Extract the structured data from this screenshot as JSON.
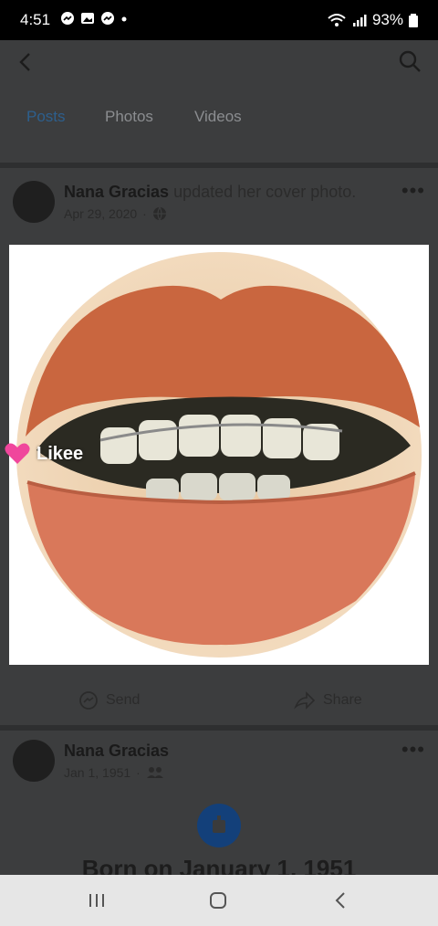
{
  "status_bar": {
    "time": "4:51",
    "battery": "93%"
  },
  "tabs": [
    {
      "label": "Posts"
    },
    {
      "label": "Photos"
    },
    {
      "label": "Videos"
    }
  ],
  "post": {
    "author": "Nana Gracias",
    "action": "updated her cover photo.",
    "date": "Apr 29, 2020",
    "privacy_icon": "globe-icon",
    "overlay_watermark": "Likee"
  },
  "post_actions": {
    "send_label": "Send",
    "share_label": "Share"
  },
  "life_event": {
    "author": "Nana Gracias",
    "date": "Jan 1, 1951",
    "privacy_icon": "friends-icon",
    "title": "Born on January 1, 1951"
  },
  "colors": {
    "accent_tab": "#2d5f8d",
    "event_icon": "#13407a"
  }
}
